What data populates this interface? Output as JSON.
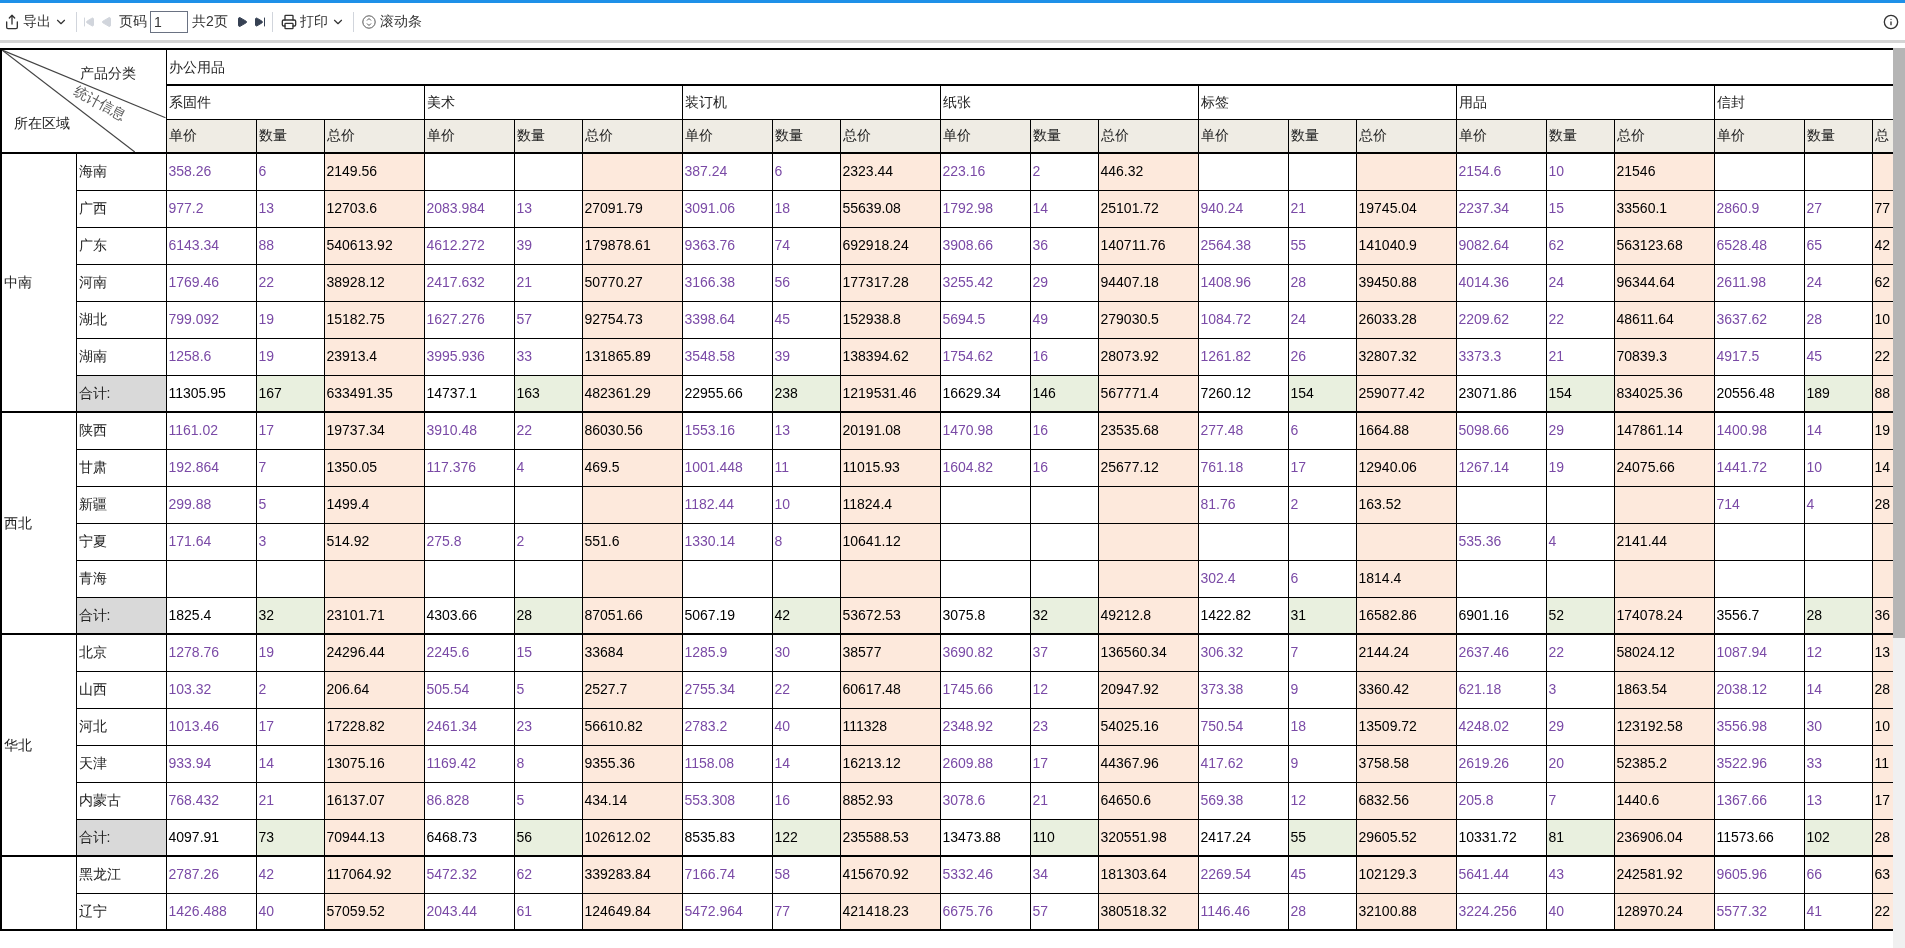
{
  "toolbar": {
    "export": "导出",
    "nav": [
      {
        "kind": "first",
        "disabled": true
      },
      {
        "kind": "prev",
        "disabled": true
      }
    ],
    "page_label": "页码",
    "page_value": "1",
    "page_total": "共2页",
    "nav_after": [
      {
        "kind": "next",
        "disabled": false
      },
      {
        "kind": "last",
        "disabled": false
      }
    ],
    "print": "打印",
    "scroll": "滚动条"
  },
  "table": {
    "corner": {
      "top": "产品分类",
      "middle": "统计信息",
      "bottom": "所在区域"
    },
    "group": "办公用品",
    "categories": [
      {
        "name": "系固件",
        "columns": [
          "单价",
          "数量",
          "总价"
        ]
      },
      {
        "name": "美术",
        "columns": [
          "单价",
          "数量",
          "总价"
        ]
      },
      {
        "name": "装订机",
        "columns": [
          "单价",
          "数量",
          "总价"
        ]
      },
      {
        "name": "纸张",
        "columns": [
          "单价",
          "数量",
          "总价"
        ]
      },
      {
        "name": "标签",
        "columns": [
          "单价",
          "数量",
          "总价"
        ]
      },
      {
        "name": "用品",
        "columns": [
          "单价",
          "数量",
          "总价"
        ]
      },
      {
        "name": "信封",
        "columns": [
          "单价",
          "数量",
          "总"
        ]
      }
    ],
    "regions": [
      {
        "name": "中南",
        "rows": [
          {
            "province": "海南",
            "cells": [
              "358.26",
              "6",
              "2149.56",
              null,
              null,
              null,
              "387.24",
              "6",
              "2323.44",
              "223.16",
              "2",
              "446.32",
              null,
              null,
              null,
              "2154.6",
              "10",
              "21546",
              null,
              null,
              null
            ]
          },
          {
            "province": "广西",
            "cells": [
              "977.2",
              "13",
              "12703.6",
              "2083.984",
              "13",
              "27091.79",
              "3091.06",
              "18",
              "55639.08",
              "1792.98",
              "14",
              "25101.72",
              "940.24",
              "21",
              "19745.04",
              "2237.34",
              "15",
              "33560.1",
              "2860.9",
              "27",
              "77"
            ]
          },
          {
            "province": "广东",
            "cells": [
              "6143.34",
              "88",
              "540613.92",
              "4612.272",
              "39",
              "179878.61",
              "9363.76",
              "74",
              "692918.24",
              "3908.66",
              "36",
              "140711.76",
              "2564.38",
              "55",
              "141040.9",
              "9082.64",
              "62",
              "563123.68",
              "6528.48",
              "65",
              "42"
            ]
          },
          {
            "province": "河南",
            "cells": [
              "1769.46",
              "22",
              "38928.12",
              "2417.632",
              "21",
              "50770.27",
              "3166.38",
              "56",
              "177317.28",
              "3255.42",
              "29",
              "94407.18",
              "1408.96",
              "28",
              "39450.88",
              "4014.36",
              "24",
              "96344.64",
              "2611.98",
              "24",
              "62"
            ]
          },
          {
            "province": "湖北",
            "cells": [
              "799.092",
              "19",
              "15182.75",
              "1627.276",
              "57",
              "92754.73",
              "3398.64",
              "45",
              "152938.8",
              "5694.5",
              "49",
              "279030.5",
              "1084.72",
              "24",
              "26033.28",
              "2209.62",
              "22",
              "48611.64",
              "3637.62",
              "28",
              "10"
            ]
          },
          {
            "province": "湖南",
            "cells": [
              "1258.6",
              "19",
              "23913.4",
              "3995.936",
              "33",
              "131865.89",
              "3548.58",
              "39",
              "138394.62",
              "1754.62",
              "16",
              "28073.92",
              "1261.82",
              "26",
              "32807.32",
              "3373.3",
              "21",
              "70839.3",
              "4917.5",
              "45",
              "22"
            ]
          }
        ],
        "total": {
          "label": "合计:",
          "cells": [
            "11305.95",
            "167",
            "633491.35",
            "14737.1",
            "163",
            "482361.29",
            "22955.66",
            "238",
            "1219531.46",
            "16629.34",
            "146",
            "567771.4",
            "7260.12",
            "154",
            "259077.42",
            "23071.86",
            "154",
            "834025.36",
            "20556.48",
            "189",
            "88"
          ]
        }
      },
      {
        "name": "西北",
        "rows": [
          {
            "province": "陕西",
            "cells": [
              "1161.02",
              "17",
              "19737.34",
              "3910.48",
              "22",
              "86030.56",
              "1553.16",
              "13",
              "20191.08",
              "1470.98",
              "16",
              "23535.68",
              "277.48",
              "6",
              "1664.88",
              "5098.66",
              "29",
              "147861.14",
              "1400.98",
              "14",
              "19"
            ]
          },
          {
            "province": "甘肃",
            "cells": [
              "192.864",
              "7",
              "1350.05",
              "117.376",
              "4",
              "469.5",
              "1001.448",
              "11",
              "11015.93",
              "1604.82",
              "16",
              "25677.12",
              "761.18",
              "17",
              "12940.06",
              "1267.14",
              "19",
              "24075.66",
              "1441.72",
              "10",
              "14"
            ]
          },
          {
            "province": "新疆",
            "cells": [
              "299.88",
              "5",
              "1499.4",
              null,
              null,
              null,
              "1182.44",
              "10",
              "11824.4",
              null,
              null,
              null,
              "81.76",
              "2",
              "163.52",
              null,
              null,
              null,
              "714",
              "4",
              "28"
            ]
          },
          {
            "province": "宁夏",
            "cells": [
              "171.64",
              "3",
              "514.92",
              "275.8",
              "2",
              "551.6",
              "1330.14",
              "8",
              "10641.12",
              null,
              null,
              null,
              null,
              null,
              null,
              "535.36",
              "4",
              "2141.44",
              null,
              null,
              null
            ]
          },
          {
            "province": "青海",
            "cells": [
              null,
              null,
              null,
              null,
              null,
              null,
              null,
              null,
              null,
              null,
              null,
              null,
              "302.4",
              "6",
              "1814.4",
              null,
              null,
              null,
              null,
              null,
              null
            ]
          }
        ],
        "total": {
          "label": "合计:",
          "cells": [
            "1825.4",
            "32",
            "23101.71",
            "4303.66",
            "28",
            "87051.66",
            "5067.19",
            "42",
            "53672.53",
            "3075.8",
            "32",
            "49212.8",
            "1422.82",
            "31",
            "16582.86",
            "6901.16",
            "52",
            "174078.24",
            "3556.7",
            "28",
            "36"
          ]
        }
      },
      {
        "name": "华北",
        "rows": [
          {
            "province": "北京",
            "cells": [
              "1278.76",
              "19",
              "24296.44",
              "2245.6",
              "15",
              "33684",
              "1285.9",
              "30",
              "38577",
              "3690.82",
              "37",
              "136560.34",
              "306.32",
              "7",
              "2144.24",
              "2637.46",
              "22",
              "58024.12",
              "1087.94",
              "12",
              "13"
            ]
          },
          {
            "province": "山西",
            "cells": [
              "103.32",
              "2",
              "206.64",
              "505.54",
              "5",
              "2527.7",
              "2755.34",
              "22",
              "60617.48",
              "1745.66",
              "12",
              "20947.92",
              "373.38",
              "9",
              "3360.42",
              "621.18",
              "3",
              "1863.54",
              "2038.12",
              "14",
              "28"
            ]
          },
          {
            "province": "河北",
            "cells": [
              "1013.46",
              "17",
              "17228.82",
              "2461.34",
              "23",
              "56610.82",
              "2783.2",
              "40",
              "111328",
              "2348.92",
              "23",
              "54025.16",
              "750.54",
              "18",
              "13509.72",
              "4248.02",
              "29",
              "123192.58",
              "3556.98",
              "30",
              "10"
            ]
          },
          {
            "province": "天津",
            "cells": [
              "933.94",
              "14",
              "13075.16",
              "1169.42",
              "8",
              "9355.36",
              "1158.08",
              "14",
              "16213.12",
              "2609.88",
              "17",
              "44367.96",
              "417.62",
              "9",
              "3758.58",
              "2619.26",
              "20",
              "52385.2",
              "3522.96",
              "33",
              "11"
            ]
          },
          {
            "province": "内蒙古",
            "cells": [
              "768.432",
              "21",
              "16137.07",
              "86.828",
              "5",
              "434.14",
              "553.308",
              "16",
              "8852.93",
              "3078.6",
              "21",
              "64650.6",
              "569.38",
              "12",
              "6832.56",
              "205.8",
              "7",
              "1440.6",
              "1367.66",
              "13",
              "17"
            ]
          }
        ],
        "total": {
          "label": "合计:",
          "cells": [
            "4097.91",
            "73",
            "70944.13",
            "6468.73",
            "56",
            "102612.02",
            "8535.83",
            "122",
            "235588.53",
            "13473.88",
            "110",
            "320551.98",
            "2417.24",
            "55",
            "29605.52",
            "10331.72",
            "81",
            "236906.04",
            "11573.66",
            "102",
            "28"
          ]
        }
      },
      {
        "rows": [
          {
            "province": "黑龙江",
            "cells": [
              "2787.26",
              "42",
              "117064.92",
              "5472.32",
              "62",
              "339283.84",
              "7166.74",
              "58",
              "415670.92",
              "5332.46",
              "34",
              "181303.64",
              "2269.54",
              "45",
              "102129.3",
              "5641.44",
              "43",
              "242581.92",
              "9605.96",
              "66",
              "63"
            ]
          },
          {
            "province": "辽宁",
            "cells": [
              "1426.488",
              "40",
              "57059.52",
              "2043.44",
              "61",
              "124649.84",
              "5472.964",
              "77",
              "421418.23",
              "6675.76",
              "57",
              "380518.32",
              "1146.46",
              "28",
              "32100.88",
              "3224.256",
              "40",
              "128970.24",
              "5577.32",
              "41",
              "22"
            ]
          }
        ]
      }
    ]
  }
}
